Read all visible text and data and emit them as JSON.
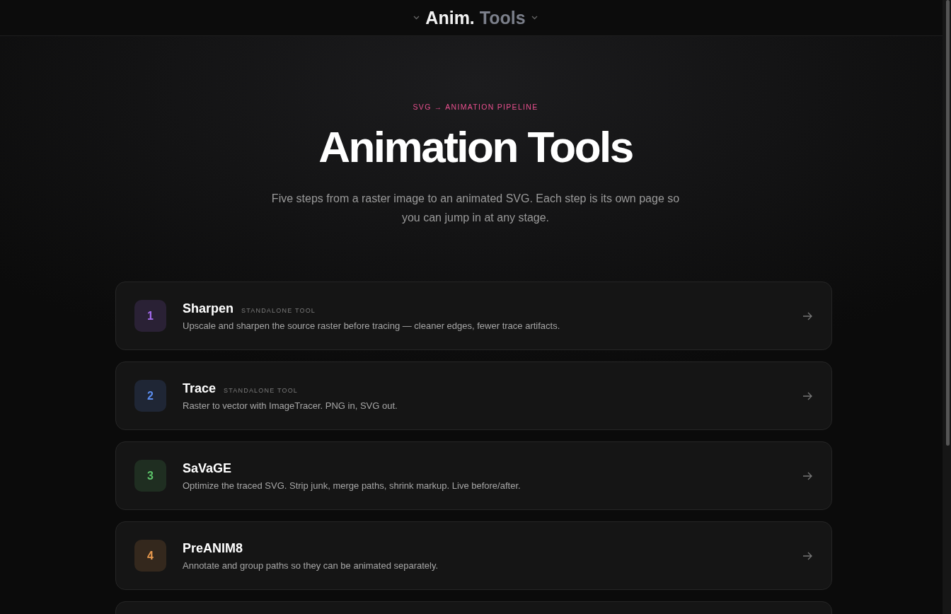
{
  "header": {
    "brand_primary": "Anim.",
    "brand_secondary": "Tools"
  },
  "hero": {
    "kicker": "SVG → ANIMATION PIPELINE",
    "title": "Animation Tools",
    "subtitle": "Five steps from a raster image to an animated SVG. Each step is its own page so you can jump in at any stage."
  },
  "steps": [
    {
      "number": "1",
      "name": "Sharpen",
      "tag": "STANDALONE TOOL",
      "description": "Upscale and sharpen the source raster before tracing — cleaner edges, fewer trace artifacts.",
      "color": "#a66cf0"
    },
    {
      "number": "2",
      "name": "Trace",
      "tag": "STANDALONE TOOL",
      "description": "Raster to vector with ImageTracer. PNG in, SVG out.",
      "color": "#5b8def"
    },
    {
      "number": "3",
      "name": "SaVaGE",
      "description": "Optimize the traced SVG. Strip junk, merge paths, shrink markup. Live before/after.",
      "color": "#5cc46a"
    },
    {
      "number": "4",
      "name": "PreANIM8",
      "description": "Annotate and group paths so they can be animated separately.",
      "color": "#e99a4e"
    }
  ]
}
